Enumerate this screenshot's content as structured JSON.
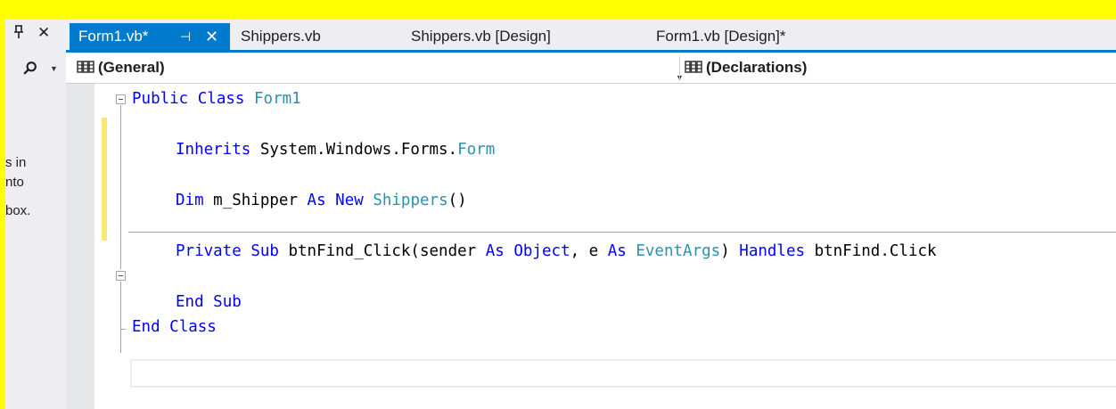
{
  "left_panel": {
    "text_lines": [
      "s in",
      "nto",
      "box."
    ]
  },
  "tabs": [
    {
      "label": "Form1.vb*",
      "active": true
    },
    {
      "label": "Shippers.vb",
      "active": false
    },
    {
      "label": "Shippers.vb [Design]",
      "active": false
    },
    {
      "label": "Form1.vb [Design]*",
      "active": false
    }
  ],
  "navbar": {
    "left_combo": "(General)",
    "right_combo": "(Declarations)"
  },
  "code": {
    "line1": {
      "kw1": "Public",
      "kw2": "Class",
      "name": "Form1"
    },
    "line2": {
      "kw": "Inherits",
      "ns": "System.Windows.Forms.",
      "type": "Form"
    },
    "line3": {
      "kw1": "Dim",
      "var": "m_Shipper",
      "kw2": "As",
      "kw3": "New",
      "type": "Shippers",
      "tail": "()"
    },
    "line4": {
      "kw1": "Private",
      "kw2": "Sub",
      "name": "btnFind_Click(sender",
      "kw3": "As",
      "type1": "Object",
      "sep": ", e",
      "kw4": "As",
      "type2": "EventArgs",
      "close": ")",
      "kw5": "Handles",
      "handler": "btnFind.Click"
    },
    "line5": {
      "kw1": "End",
      "kw2": "Sub"
    },
    "line6": {
      "kw1": "End",
      "kw2": "Class"
    }
  },
  "colors": {
    "accent": "#007acc",
    "keyword": "#0000ff",
    "type": "#2b91af",
    "changed_line": "#fce571",
    "highlight_border": "#ffff00"
  }
}
